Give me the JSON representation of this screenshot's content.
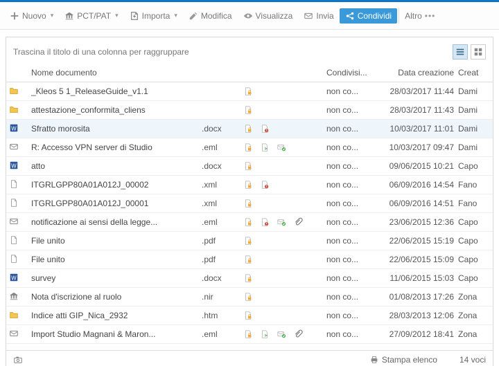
{
  "toolbar": {
    "nuovo": "Nuovo",
    "pctpat": "PCT/PAT",
    "importa": "Importa",
    "modifica": "Modifica",
    "visualizza": "Visualizza",
    "invia": "Invia",
    "condividi": "Condividi",
    "altro": "Altro"
  },
  "panel": {
    "group_hint": "Trascina il titolo di una colonna per raggruppare"
  },
  "columns": {
    "name": "Nome documento",
    "share": "Condivisi...",
    "date": "Data creazione",
    "creator": "Creat"
  },
  "statusbar": {
    "print": "Stampa elenco",
    "count": "14 voci"
  },
  "rows": [
    {
      "icon": "folder",
      "name": "_Kleos 5 1_ReleaseGuide_v1.1",
      "ext": "",
      "flags": [
        "lock"
      ],
      "share": "non co...",
      "date": "28/03/2017 11:44",
      "creator": "Dami"
    },
    {
      "icon": "folder",
      "name": "attestazione_conformita_cliens",
      "ext": "",
      "flags": [
        "lock"
      ],
      "share": "non co...",
      "date": "28/03/2017 11:43",
      "creator": "Dami"
    },
    {
      "icon": "word",
      "name": "Sfratto morosita",
      "ext": ".docx",
      "flags": [
        "lock",
        "err"
      ],
      "share": "non co...",
      "date": "10/03/2017 11:01",
      "creator": "Dami",
      "selected": true
    },
    {
      "icon": "mail",
      "name": "R: Accesso VPN server di Studio",
      "ext": ".eml",
      "flags": [
        "lock",
        "send",
        "ok"
      ],
      "share": "non co...",
      "date": "10/03/2017 09:47",
      "creator": "Dami"
    },
    {
      "icon": "word",
      "name": "atto",
      "ext": ".docx",
      "flags": [
        "lock"
      ],
      "share": "non co...",
      "date": "09/06/2015 10:21",
      "creator": "Capo"
    },
    {
      "icon": "file",
      "name": "ITGRLGPP80A01A012J_00002",
      "ext": ".xml",
      "flags": [
        "lock",
        "err"
      ],
      "share": "non co...",
      "date": "06/09/2016 14:54",
      "creator": "Fano"
    },
    {
      "icon": "file",
      "name": "ITGRLGPP80A01A012J_00001",
      "ext": ".xml",
      "flags": [
        "lock"
      ],
      "share": "non co...",
      "date": "06/09/2016 14:51",
      "creator": "Fano"
    },
    {
      "icon": "mail",
      "name": "notificazione ai sensi della legge...",
      "ext": ".eml",
      "flags": [
        "lock",
        "err",
        "ok",
        "attach"
      ],
      "share": "non co...",
      "date": "23/06/2015 12:36",
      "creator": "Capo"
    },
    {
      "icon": "file",
      "name": "File unito",
      "ext": ".pdf",
      "flags": [
        "lock"
      ],
      "share": "non co...",
      "date": "22/06/2015 15:19",
      "creator": "Capo"
    },
    {
      "icon": "file",
      "name": "File unito",
      "ext": ".pdf",
      "flags": [
        "lock"
      ],
      "share": "non co...",
      "date": "22/06/2015 15:09",
      "creator": "Capo"
    },
    {
      "icon": "word",
      "name": "survey",
      "ext": ".docx",
      "flags": [
        "lock"
      ],
      "share": "non co...",
      "date": "11/06/2015 15:03",
      "creator": "Capo"
    },
    {
      "icon": "court",
      "name": "Nota d'iscrizione al ruolo",
      "ext": ".nir",
      "flags": [
        "lock"
      ],
      "share": "non co...",
      "date": "01/08/2013 17:26",
      "creator": "Zona"
    },
    {
      "icon": "folder",
      "name": "Indice atti GIP_Nica_2932",
      "ext": ".htm",
      "flags": [
        "lock"
      ],
      "share": "non co...",
      "date": "28/03/2013 12:06",
      "creator": "Zona"
    },
    {
      "icon": "mail",
      "name": "Import Studio Magnani & Maron...",
      "ext": ".eml",
      "flags": [
        "lock",
        "send",
        "ok",
        "attach"
      ],
      "share": "non co...",
      "date": "27/09/2012 18:41",
      "creator": "Zona"
    }
  ]
}
